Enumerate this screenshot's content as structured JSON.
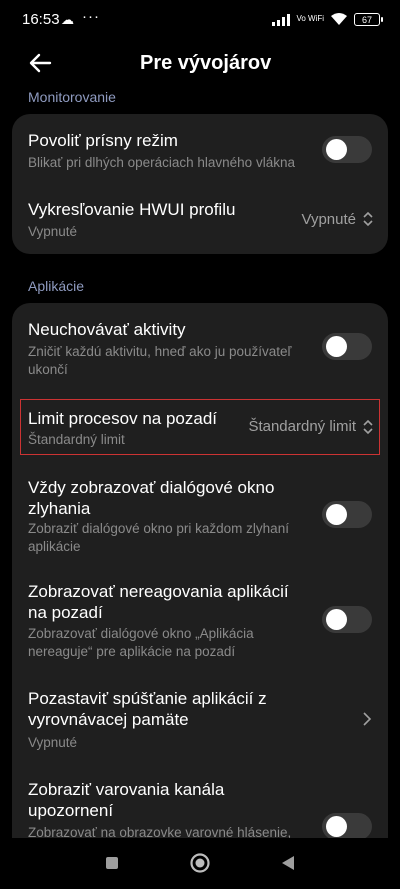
{
  "status_bar": {
    "time": "16:53",
    "cloud_icon": "cloud-icon",
    "dots": "···",
    "net_label": "Vo WiFi",
    "battery": "67"
  },
  "header": {
    "title": "Pre vývojárov",
    "back_icon": "arrow-left-icon"
  },
  "sections": {
    "monitoring": "Monitorovanie",
    "apps": "Aplikácie"
  },
  "monitoring_items": {
    "strict_mode": {
      "title": "Povoliť prísny režim",
      "subtitle": "Blikať pri dlhých operáciach hlavného vlákna",
      "enabled": false
    },
    "hwui": {
      "title": "Vykresľovanie HWUI profilu",
      "subtitle": "Vypnuté",
      "value": "Vypnuté"
    }
  },
  "app_items": {
    "dont_keep": {
      "title": "Neuchovávať aktivity",
      "subtitle": "Zničiť každú aktivitu, hneď ako ju používateľ ukončí",
      "enabled": false
    },
    "bg_limit": {
      "title": "Limit procesov na pozadí",
      "subtitle": "Štandardný limit",
      "value": "Štandardný limit"
    },
    "crash_dialog": {
      "title": "Vždy zobrazovať dialógové okno zlyhania",
      "subtitle": "Zobraziť dialógové okno pri každom zlyhaní aplikácie",
      "enabled": false
    },
    "anr_bg": {
      "title": "Zobrazovať nereagovania aplikácií na pozadí",
      "subtitle": "Zobrazovať dialógové okno „Aplikácia nereaguje“ pre aplikácie na pozadí",
      "enabled": false
    },
    "cached_exec": {
      "title": "Pozastaviť spúšťanie aplikácií z vyrovnávacej pamäte",
      "subtitle": "Vypnuté"
    },
    "channel_warn": {
      "title": "Zobraziť varovania kanála upozornení",
      "subtitle": "Zobrazovať na obrazovke varovné hlásenie,",
      "enabled": false
    }
  },
  "navbar": {
    "recents_icon": "square-icon",
    "home_icon": "circle-icon",
    "back_icon": "triangle-back-icon"
  }
}
